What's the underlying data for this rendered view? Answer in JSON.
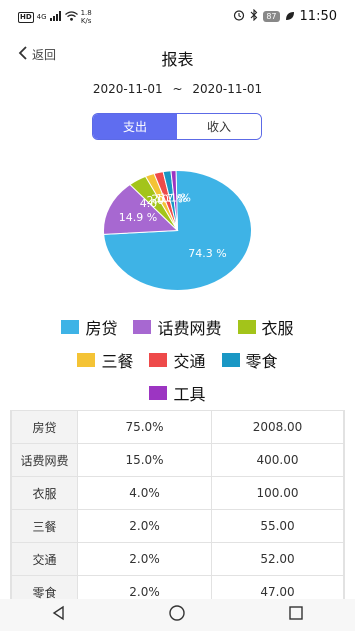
{
  "status_bar": {
    "network": "HD",
    "signal": "4G",
    "speed_value": "1.8",
    "speed_unit": "K/s",
    "battery": "87",
    "time": "11:50"
  },
  "nav": {
    "back_label": "返回",
    "title": "报表"
  },
  "date_range": {
    "start": "2020-11-01",
    "separator": "~",
    "end": "2020-11-01"
  },
  "tabs": [
    {
      "label": "支出",
      "active": true
    },
    {
      "label": "收入",
      "active": false
    }
  ],
  "chart_data": {
    "type": "pie",
    "slices": [
      {
        "name": "房贷",
        "value": 74.3,
        "color": "#3eb3e6"
      },
      {
        "name": "话费网费",
        "value": 14.9,
        "color": "#a768d1"
      },
      {
        "name": "衣服",
        "value": 4.0,
        "color": "#a3c41a"
      },
      {
        "name": "三餐",
        "value": 2.0,
        "color": "#f4c335"
      },
      {
        "name": "交通",
        "value": 2.0,
        "color": "#ee4a4a"
      },
      {
        "name": "零食",
        "value": 1.7,
        "color": "#1997c4"
      },
      {
        "name": "工具",
        "value": 1.1,
        "color": "#9c35c2"
      }
    ],
    "labels": [
      "74.3 %",
      "14.9 %",
      "4.0 %",
      "2.0 %",
      "2.0 %",
      "1.7 %",
      "1.1 %"
    ]
  },
  "legend": [
    {
      "name": "房贷",
      "color": "#3eb3e6"
    },
    {
      "name": "话费网费",
      "color": "#a768d1"
    },
    {
      "name": "衣服",
      "color": "#a3c41a"
    },
    {
      "name": "三餐",
      "color": "#f4c335"
    },
    {
      "name": "交通",
      "color": "#ee4a4a"
    },
    {
      "name": "零食",
      "color": "#1997c4"
    },
    {
      "name": "工具",
      "color": "#9c35c2"
    }
  ],
  "table": [
    [
      "房贷",
      "75.0%",
      "2008.00"
    ],
    [
      "话费网费",
      "15.0%",
      "400.00"
    ],
    [
      "衣服",
      "4.0%",
      "100.00"
    ],
    [
      "三餐",
      "2.0%",
      "55.00"
    ],
    [
      "交通",
      "2.0%",
      "52.00"
    ],
    [
      "零食",
      "2.0%",
      "47.00"
    ]
  ]
}
